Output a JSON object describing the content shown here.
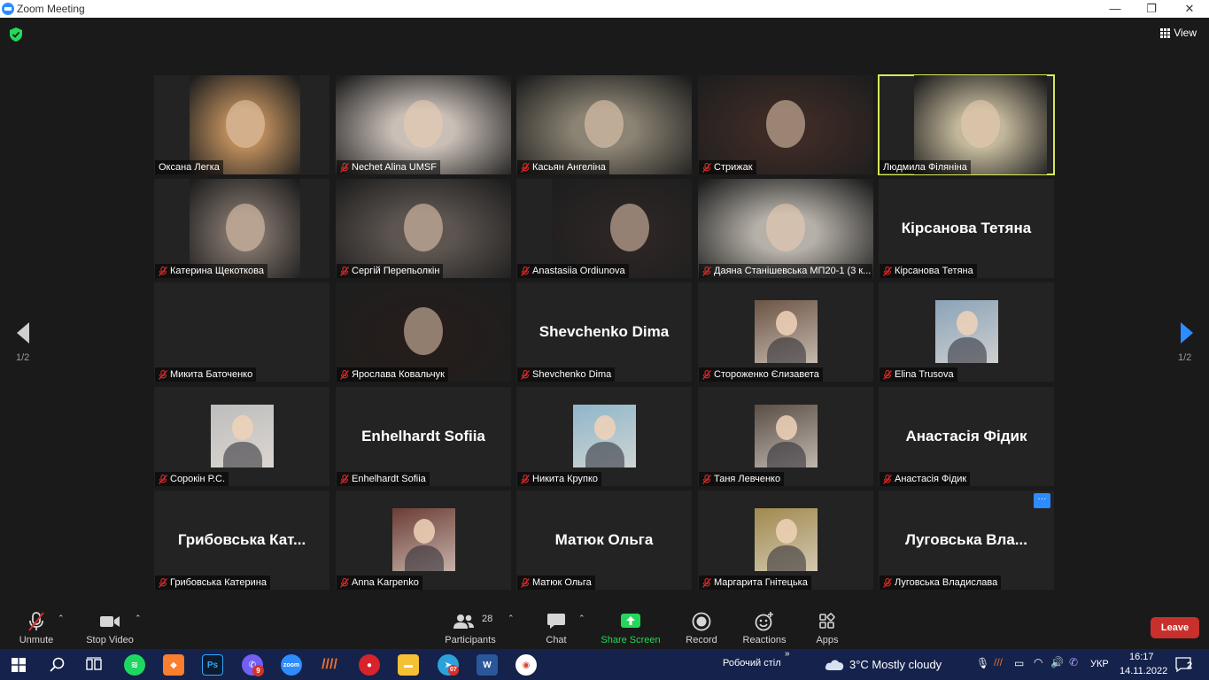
{
  "window": {
    "title": "Zoom Meeting",
    "minimize": "—",
    "restore": "❐",
    "close": "✕"
  },
  "header": {
    "view_label": "View"
  },
  "pager": {
    "left": "1/2",
    "right": "1/2"
  },
  "participants": [
    {
      "name": "Оксана Легка",
      "muted": false,
      "kind": "video",
      "tone": "#b88a5a"
    },
    {
      "name": "Nechet Alina UMSF",
      "muted": true,
      "kind": "video",
      "tone": "#c9bfb7"
    },
    {
      "name": "Касьян Ангеліна",
      "muted": true,
      "kind": "video",
      "tone": "#8b8373"
    },
    {
      "name": "Стрижак",
      "muted": true,
      "kind": "video",
      "tone": "#3b2a25"
    },
    {
      "name": "Людмила Філяніна",
      "muted": false,
      "kind": "video",
      "tone": "#c2b79a",
      "active": true
    },
    {
      "name": "Катерина Щекоткова",
      "muted": true,
      "kind": "video",
      "tone": "#7a6e66"
    },
    {
      "name": "Сергій Перепьолкін",
      "muted": true,
      "kind": "video",
      "tone": "#5d5550"
    },
    {
      "name": "Anastasiia Ordiunova",
      "muted": true,
      "kind": "video",
      "tone": "#2b2524"
    },
    {
      "name": "Даяна Станішевська МП20-1 (3 к...",
      "muted": true,
      "kind": "video",
      "tone": "#b5b0a8"
    },
    {
      "name": "Кірсанова Тетяна",
      "muted": true,
      "kind": "name",
      "big": "Кірсанова Тетяна"
    },
    {
      "name": "Микита Баточенко",
      "muted": true,
      "kind": "blank"
    },
    {
      "name": "Ярослава Ковальчук",
      "muted": true,
      "kind": "video",
      "tone": "#241d1b"
    },
    {
      "name": "Shevchenko Dima",
      "muted": true,
      "kind": "name",
      "big": "Shevchenko Dima"
    },
    {
      "name": "Стороженко Єлизавета",
      "muted": true,
      "kind": "photo",
      "tone": "#6b5444"
    },
    {
      "name": "Elina Trusova",
      "muted": true,
      "kind": "photo",
      "tone": "#8aa3b8"
    },
    {
      "name": "Сорокін Р.С.",
      "muted": true,
      "kind": "photo",
      "tone": "#bdbdbd"
    },
    {
      "name": "Enhelhardt Sofiia",
      "muted": true,
      "kind": "name",
      "big": "Enhelhardt Sofiia"
    },
    {
      "name": "Никита Крупко",
      "muted": true,
      "kind": "photo",
      "tone": "#8fb6c9"
    },
    {
      "name": "Таня Левченко",
      "muted": true,
      "kind": "photo",
      "tone": "#5a4e45"
    },
    {
      "name": "Анастасія Фідик",
      "muted": true,
      "kind": "name",
      "big": "Анастасія Фідик"
    },
    {
      "name": "Грибовська Катерина",
      "muted": true,
      "kind": "name",
      "big": "Грибовська Кат..."
    },
    {
      "name": "Anna Karpenko",
      "muted": true,
      "kind": "photo",
      "tone": "#6b3d35"
    },
    {
      "name": "Матюк Ольга",
      "muted": true,
      "kind": "name",
      "big": "Матюк Ольга"
    },
    {
      "name": "Маргарита Гнітецька",
      "muted": true,
      "kind": "photo",
      "tone": "#a08a4e"
    },
    {
      "name": "Луговська Владислава",
      "muted": true,
      "kind": "name",
      "big": "Луговська Вла...",
      "more": "···"
    }
  ],
  "toolbar": {
    "unmute": "Unmute",
    "stop_video": "Stop Video",
    "participants": "Participants",
    "participants_count": "28",
    "chat": "Chat",
    "share_screen": "Share Screen",
    "record": "Record",
    "reactions": "Reactions",
    "apps": "Apps",
    "leave": "Leave"
  },
  "taskbar": {
    "desktop_label": "Робочий стіл",
    "weather": "3°C  Mostly cloudy",
    "language": "УКР",
    "time": "16:17",
    "date": "14.11.2022",
    "notifications": "2",
    "viber_badge": "9",
    "telegram_badge": "07",
    "colors": {
      "bar": "#14224c",
      "accent": "#2d8cff",
      "leave": "#c9302c",
      "share": "#23d959"
    }
  }
}
